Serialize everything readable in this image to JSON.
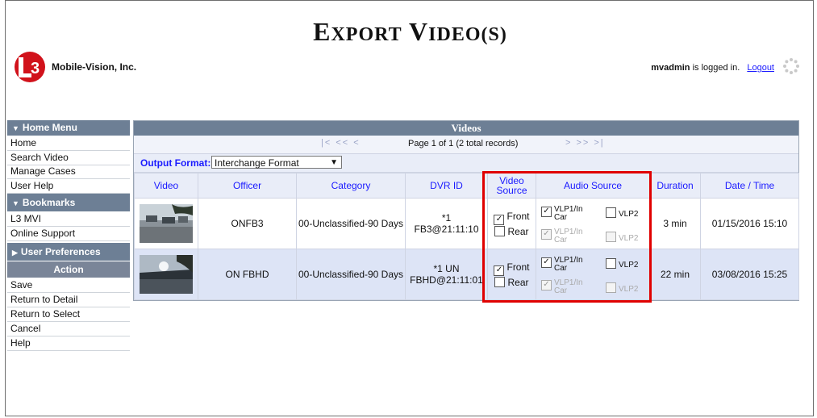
{
  "page": {
    "title_first": "E",
    "title_first_rest": "XPORT",
    "title_second": "V",
    "title_second_rest": "IDEO",
    "title_suffix": "(S)",
    "company": "Mobile-Vision, Inc.",
    "logo_text": "3",
    "user": "mvadmin",
    "logged_in_text": "is logged in.",
    "logout_label": "Logout"
  },
  "sidebar": {
    "home_menu": "Home Menu",
    "home_items": [
      "Home",
      "Search Video",
      "Manage Cases",
      "User Help"
    ],
    "bookmarks": "Bookmarks",
    "bookmark_items": [
      "L3 MVI",
      "Online Support"
    ],
    "user_prefs": "User Preferences",
    "action": "Action",
    "action_items": [
      "Save",
      "Return to Detail",
      "Return to Select",
      "Cancel",
      "Help"
    ]
  },
  "videos": {
    "heading": "Videos",
    "nav_left": "|<  <<  <",
    "page_info": "Page 1 of 1 (2 total records)",
    "nav_right": ">  >>  >|",
    "output_format_label": "Output Format:",
    "output_format_value": "Interchange Format",
    "columns": [
      "Video",
      "Officer",
      "Category",
      "DVR ID",
      "Video Source",
      "Audio Source",
      "Duration",
      "Date / Time"
    ],
    "rows": [
      {
        "officer": "ONFB3",
        "category": "00-Unclassified-90 Days",
        "dvr_id_1": "*1",
        "dvr_id_2": "FB3@21:11:10",
        "front": "Front",
        "rear": "Rear",
        "front_checked": true,
        "rear_checked": false,
        "audio_a": "VLP1/In Car",
        "audio_b": "VLP2",
        "audio_c": "VLP1/In Car",
        "audio_d": "VLP2",
        "duration": "3 min",
        "datetime": "01/15/2016 15:10"
      },
      {
        "officer": "ON FBHD",
        "category": "00-Unclassified-90 Days",
        "dvr_id_1": "*1 UN",
        "dvr_id_2": "FBHD@21:11:01",
        "front": "Front",
        "rear": "Rear",
        "front_checked": true,
        "rear_checked": false,
        "audio_a": "VLP1/In Car",
        "audio_b": "VLP2",
        "audio_c": "VLP1/In Car",
        "audio_d": "VLP2",
        "duration": "22 min",
        "datetime": "03/08/2016 15:25"
      }
    ]
  },
  "colors": {
    "header_bg": "#6d7f95",
    "link": "#1a1aff",
    "highlight": "#e00000",
    "row_alt": "#dde4f6"
  },
  "icons": [
    "l3-logo-icon",
    "loading-spinner-icon",
    "triangle-down-icon",
    "triangle-right-icon",
    "checkbox-icon"
  ]
}
